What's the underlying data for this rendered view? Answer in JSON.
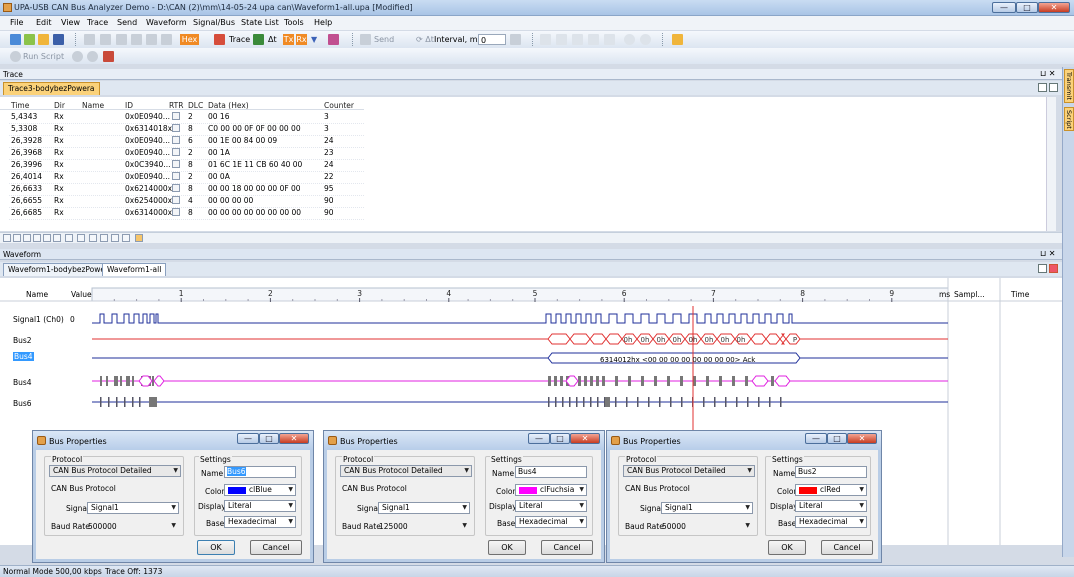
{
  "window": {
    "title": "UPA-USB CAN Bus Analyzer Demo - D:\\CAN (2)\\mm\\14-05-24 upa can\\Waveform1-all.upa [Modified]"
  },
  "menu": [
    "File",
    "Edit",
    "View",
    "Trace",
    "Send",
    "Waveform",
    "Signal/Bus",
    "State List",
    "Tools",
    "Help"
  ],
  "toolbar": {
    "hex": "Hex",
    "trace": "Trace",
    "tx": "Tx",
    "rx": "Rx",
    "send": "Send",
    "interval_label": "Interval, ms",
    "interval_value": "0",
    "run_script": "Run Script"
  },
  "trace": {
    "panel_title": "Trace",
    "tab": "Trace3-bodybezPowera",
    "columns": [
      "Time",
      "Dir",
      "Name",
      "ID",
      "RTR",
      "DLC",
      "Data (Hex)",
      "Counter"
    ],
    "rows": [
      [
        "5,4343",
        "Rx",
        "",
        "0x0E0940...",
        "",
        "2",
        "00 16",
        "3"
      ],
      [
        "5,3308",
        "Rx",
        "",
        "0x6314018x",
        "",
        "8",
        "C0 00 00 0F 0F 00 00 00",
        "3"
      ],
      [
        "26,3928",
        "Rx",
        "",
        "0x0E0940...",
        "",
        "6",
        "00 1E 00 84 00 09",
        "24"
      ],
      [
        "26,3968",
        "Rx",
        "",
        "0x0E0940...",
        "",
        "2",
        "00 1A",
        "23"
      ],
      [
        "26,3996",
        "Rx",
        "",
        "0x0C3940...",
        "",
        "8",
        "01 6C 1E 11 CB 60 40 00",
        "24"
      ],
      [
        "26,4014",
        "Rx",
        "",
        "0x0E0940...",
        "",
        "2",
        "00 0A",
        "22"
      ],
      [
        "26,6633",
        "Rx",
        "",
        "0x6214000x",
        "",
        "8",
        "00 00 18 00 00 00 0F 00",
        "95"
      ],
      [
        "26,6655",
        "Rx",
        "",
        "0x6254000x",
        "",
        "4",
        "00 00 00 00",
        "90"
      ],
      [
        "26,6685",
        "Rx",
        "",
        "0x6314000x",
        "",
        "8",
        "00 00 00 00 00 00 00 00",
        "90"
      ]
    ]
  },
  "waveform": {
    "panel_title": "Waveform",
    "tabs": [
      "Waveform1-bodybezPowera",
      "Waveform1-all"
    ],
    "header": {
      "name": "Name",
      "value": "Value",
      "unit": "ms",
      "sample": "Sampl...",
      "time": "Time"
    },
    "ticks": [
      "1",
      "2",
      "3",
      "4",
      "5",
      "6",
      "7",
      "8",
      "9"
    ],
    "signals": [
      {
        "name": "Signal1 (Ch0)",
        "value": "0"
      },
      {
        "name": "Bus2",
        "value": ""
      },
      {
        "name": "Bus4",
        "value": ""
      },
      {
        "name": "Bus4",
        "value": ""
      },
      {
        "name": "Bus6",
        "value": ""
      }
    ],
    "decoded_bus2": [
      "0h",
      "0h",
      "0h",
      "0h",
      "0h",
      "0h",
      "0h",
      "0h",
      "P"
    ],
    "decoded_bus4": "6314012hx <00 00 00 00 00 00 00 00> Ack"
  },
  "colors": {
    "blue": "#1f2f9a",
    "red": "#e03030",
    "fuchsia": "#e020e0",
    "selection": "#3399ff"
  },
  "side_tabs": [
    "Transmit",
    "Script"
  ],
  "dialogs": [
    {
      "title": "Bus Properties",
      "protocol_label": "Protocol",
      "protocol": "CAN Bus Protocol Detailed",
      "protocol_sub": "CAN Bus Protocol",
      "signal_label": "Signal",
      "signal": "Signal1",
      "baud_label": "Baud Rate",
      "baud": "500000",
      "settings_label": "Settings",
      "name_label": "Name",
      "name": "Bus6",
      "color_label": "Color",
      "color_name": "clBlue",
      "color": "#0000ff",
      "display_label": "Display",
      "display": "Literal",
      "base_label": "Base",
      "base": "Hexadecimal",
      "ok": "OK",
      "cancel": "Cancel"
    },
    {
      "title": "Bus Properties",
      "protocol_label": "Protocol",
      "protocol": "CAN Bus Protocol Detailed",
      "protocol_sub": "CAN Bus Protocol",
      "signal_label": "Signal",
      "signal": "Signal1",
      "baud_label": "Baud Rate",
      "baud": "125000",
      "settings_label": "Settings",
      "name_label": "Name",
      "name": "Bus4",
      "color_label": "Color",
      "color_name": "clFuchsia",
      "color": "#ff00ff",
      "display_label": "Display",
      "display": "Literal",
      "base_label": "Base",
      "base": "Hexadecimal",
      "ok": "OK",
      "cancel": "Cancel"
    },
    {
      "title": "Bus Properties",
      "protocol_label": "Protocol",
      "protocol": "CAN Bus Protocol Detailed",
      "protocol_sub": "CAN Bus Protocol",
      "signal_label": "Signal",
      "signal": "Signal1",
      "baud_label": "Baud Rate",
      "baud": "50000",
      "settings_label": "Settings",
      "name_label": "Name",
      "name": "Bus2",
      "color_label": "Color",
      "color_name": "clRed",
      "color": "#ff0000",
      "display_label": "Display",
      "display": "Literal",
      "base_label": "Base",
      "base": "Hexadecimal",
      "ok": "OK",
      "cancel": "Cancel"
    }
  ],
  "status": {
    "mode": "Normal Mode 500,00 kbps",
    "trace": "Trace Off: 1373"
  }
}
